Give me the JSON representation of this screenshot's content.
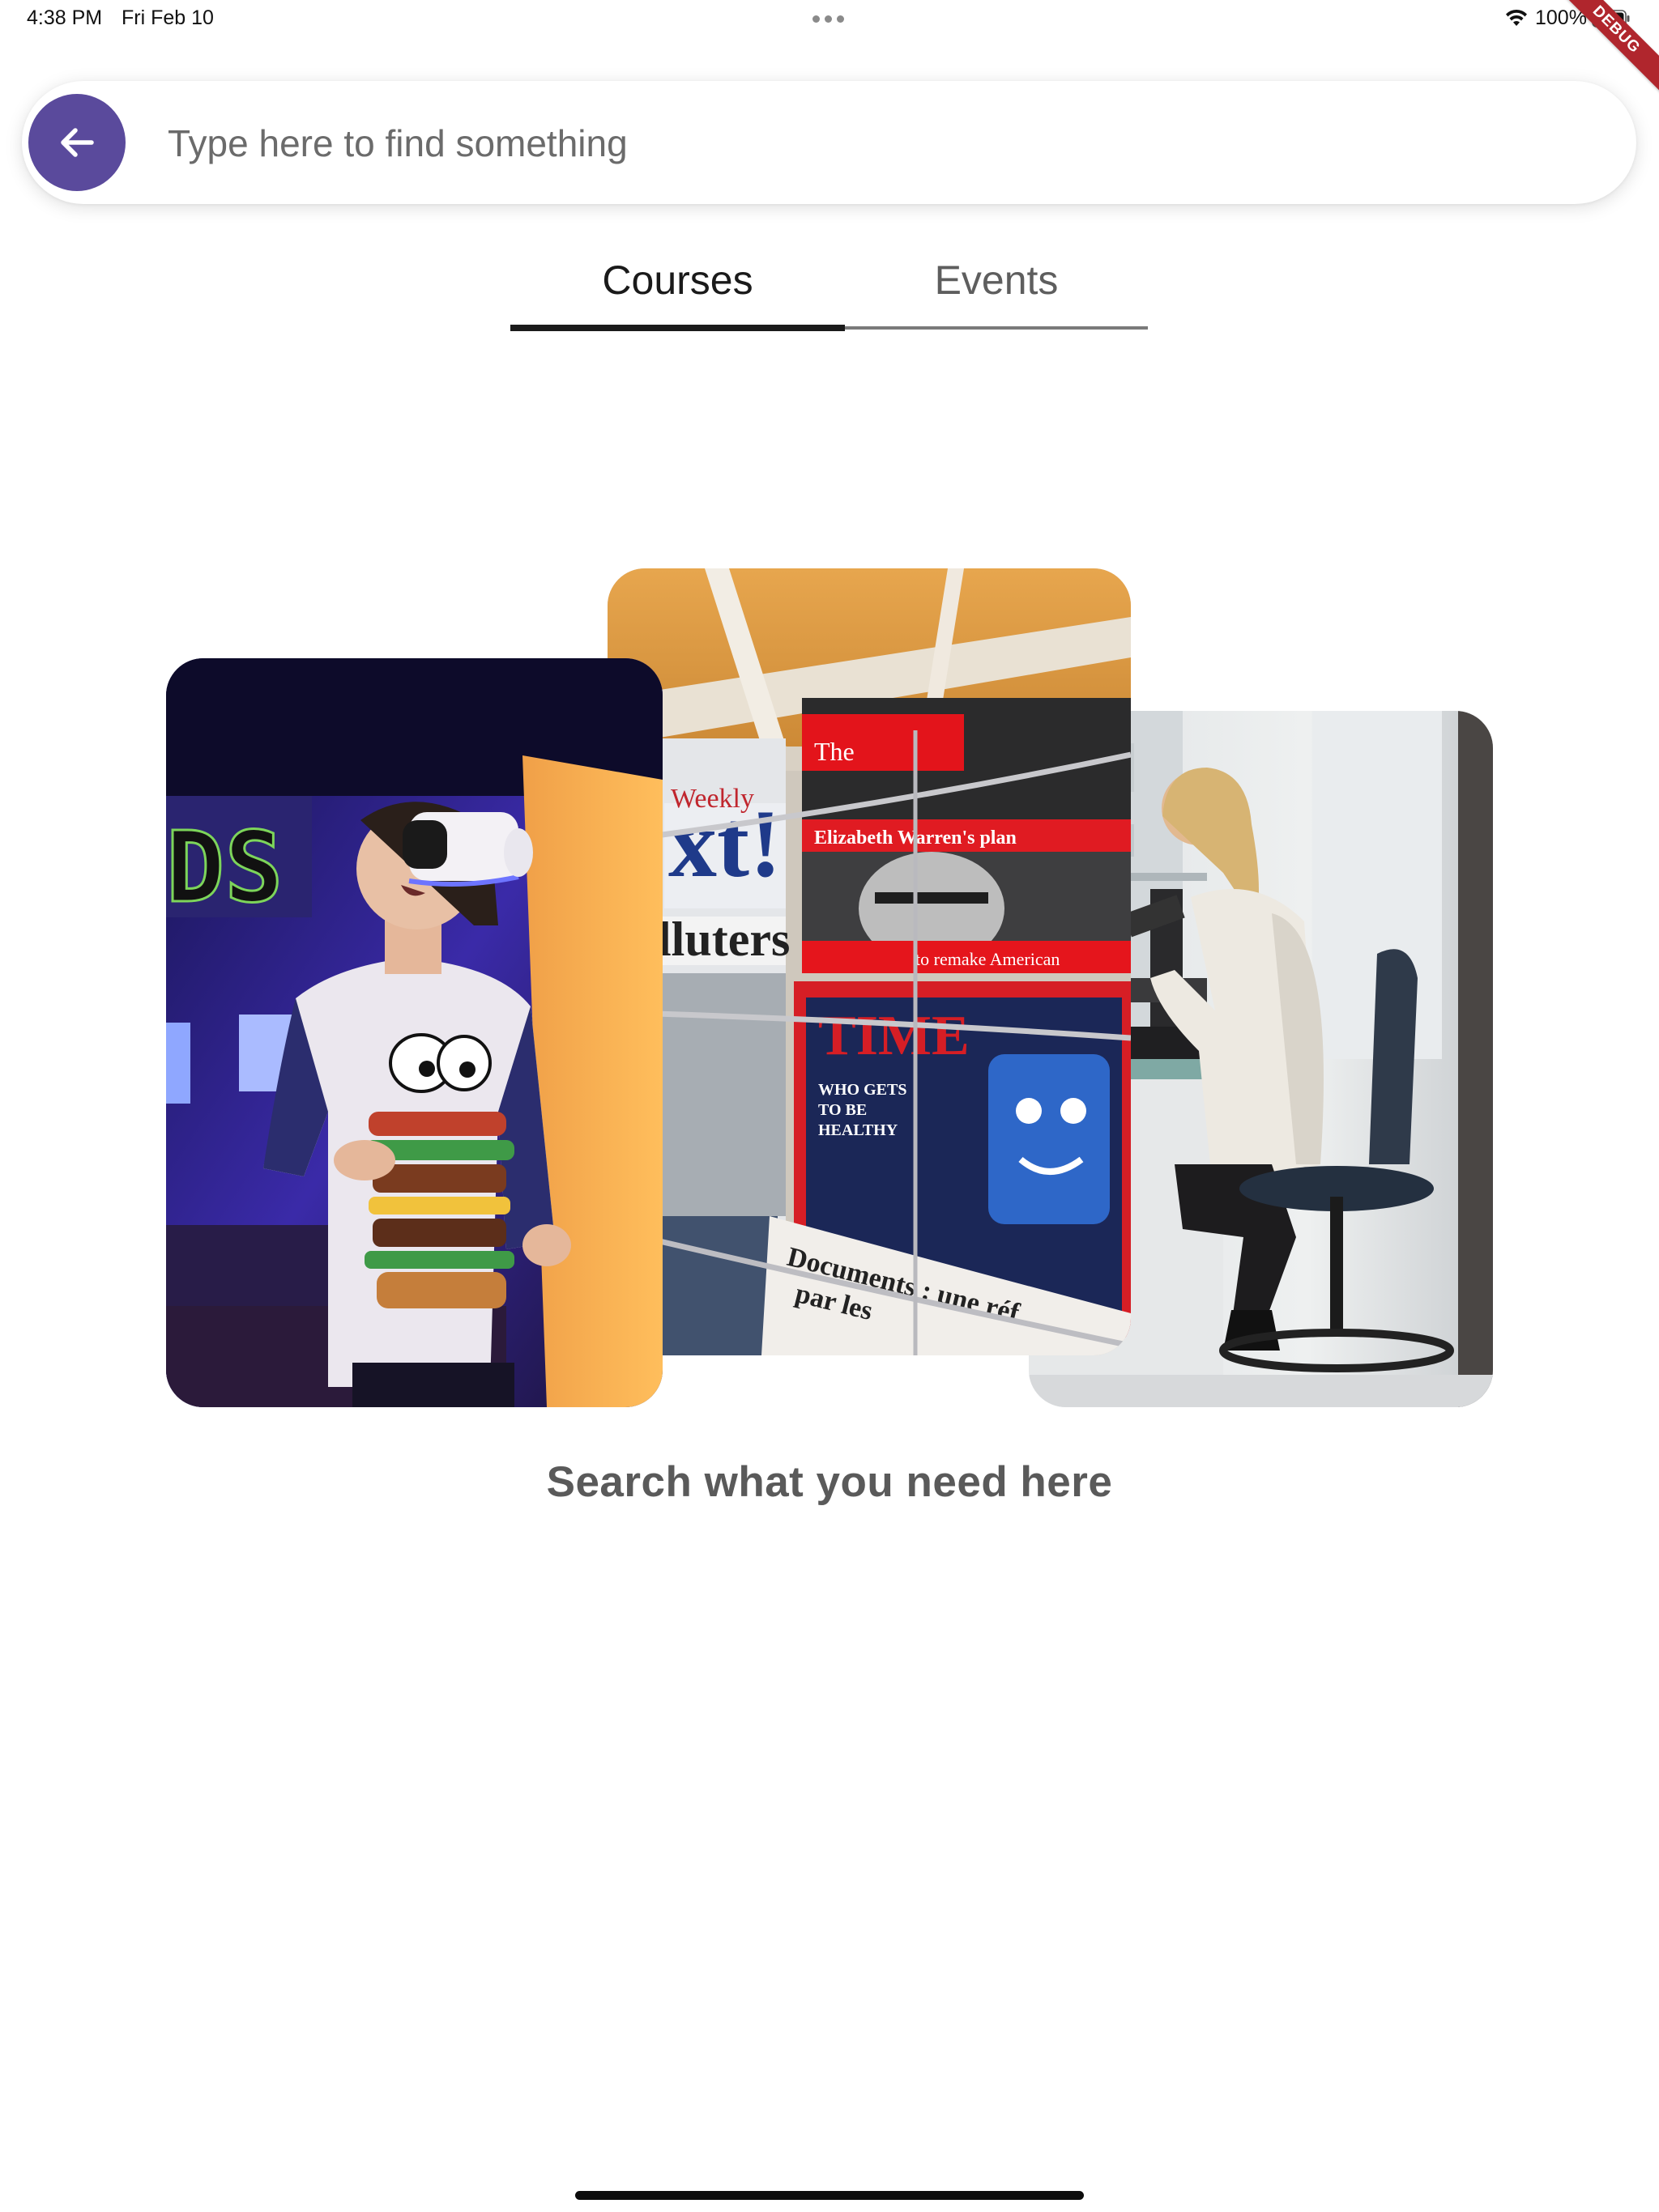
{
  "status_bar": {
    "time": "4:38 PM",
    "date": "Fri Feb 10",
    "battery": "100%",
    "debug_banner": "DEBUG"
  },
  "search": {
    "placeholder": "Type here to find something",
    "value": "",
    "back_icon": "arrow-left-icon",
    "accent_color": "#5a4a9c"
  },
  "tabs": [
    {
      "label": "Courses",
      "selected": true
    },
    {
      "label": "Events",
      "selected": false
    }
  ],
  "illustration": {
    "images": [
      "vr-headset-photo",
      "magazine-rack-photo",
      "laboratory-microscope-photo"
    ],
    "magazine_text": {
      "economist_logo": "The",
      "economist_headline": "Elizabeth Warren's plan",
      "economist_sub": "to remake American",
      "time_logo": "TIME",
      "time_line1": "WHO GETS",
      "time_line2": "TO BE",
      "time_line3": "HEALTHY",
      "documents_line1": "Documents : une réf",
      "documents_line2": "par les"
    }
  },
  "caption": "Search what you need here"
}
